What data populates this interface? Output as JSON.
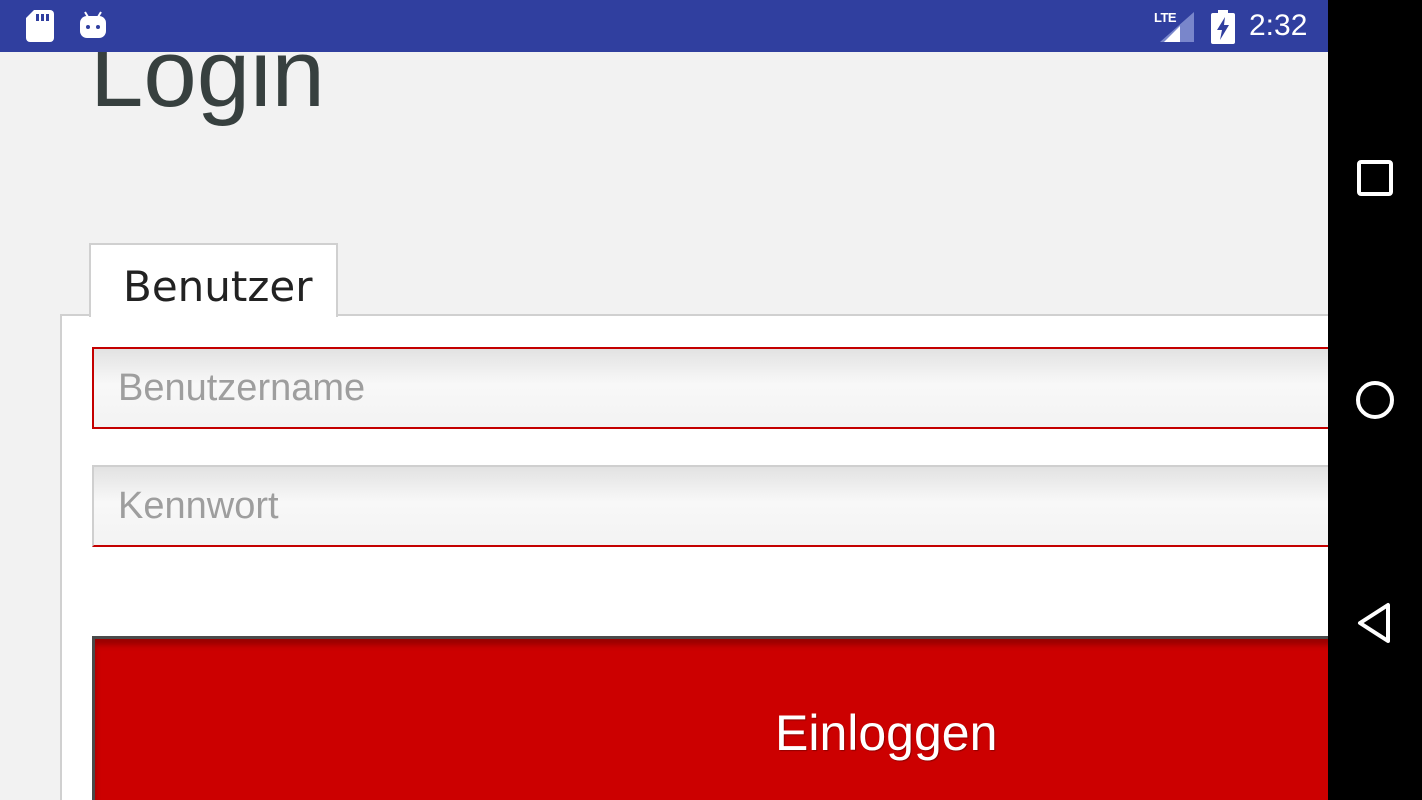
{
  "status_bar": {
    "network_type": "LTE",
    "time": "2:32",
    "icons": [
      "sd-card-icon",
      "android-debug-icon",
      "signal-icon",
      "battery-charging-icon"
    ]
  },
  "page": {
    "title": "Login"
  },
  "tabs": [
    {
      "label": "Benutzer",
      "active": true
    }
  ],
  "form": {
    "username_placeholder": "Benutzername",
    "password_placeholder": "Kennwort",
    "submit_label": "Einloggen"
  },
  "nav_bar": {
    "icons": [
      "recents-icon",
      "home-icon",
      "back-icon"
    ]
  },
  "colors": {
    "status_bar": "#303f9f",
    "accent_red": "#cc0000",
    "background": "#f2f2f2"
  }
}
